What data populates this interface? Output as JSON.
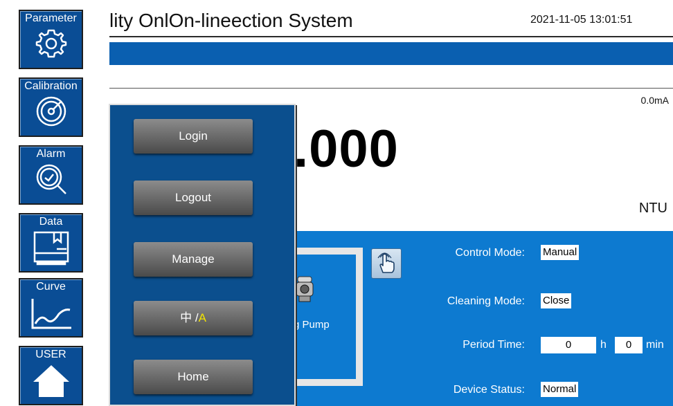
{
  "header": {
    "title": "lity OnlOn-lineection System",
    "datetime": "2021-11-05 13:01:51"
  },
  "measurement": {
    "current": "0.0mA",
    "value": ".000",
    "unit": "NTU"
  },
  "pump": {
    "label": "g Pump"
  },
  "controls": {
    "control_mode_label": "Control Mode:",
    "control_mode_value": "Manual",
    "cleaning_mode_label": "Cleaning Mode:",
    "cleaning_mode_value": "Close",
    "period_time_label": "Period Time:",
    "period_hours": "0",
    "hours_unit": "h",
    "period_minutes": "0",
    "minutes_unit": "min",
    "device_status_label": "Device Status:",
    "device_status_value": "Normal"
  },
  "sidebar": {
    "items": [
      {
        "label": "Parameter",
        "icon": "gear-icon"
      },
      {
        "label": "Calibration",
        "icon": "gauge-icon"
      },
      {
        "label": "Alarm",
        "icon": "magnifier-icon"
      },
      {
        "label": "Data",
        "icon": "data-folder-icon"
      },
      {
        "label": "Curve",
        "icon": "curve-chart-icon"
      },
      {
        "label": "USER",
        "icon": "home-icon"
      }
    ]
  },
  "user_menu": {
    "login": "Login",
    "logout": "Logout",
    "manage": "Manage",
    "lang_cn": "中",
    "lang_sep": "/",
    "lang_en": "A",
    "home": "Home"
  },
  "colors": {
    "nav_button": "#0a4d95",
    "header_bar": "#0a5fb0",
    "control_panel": "#0d7ad0",
    "menu_bg": "#0b4f8e",
    "lang_highlight": "#f2e300"
  }
}
